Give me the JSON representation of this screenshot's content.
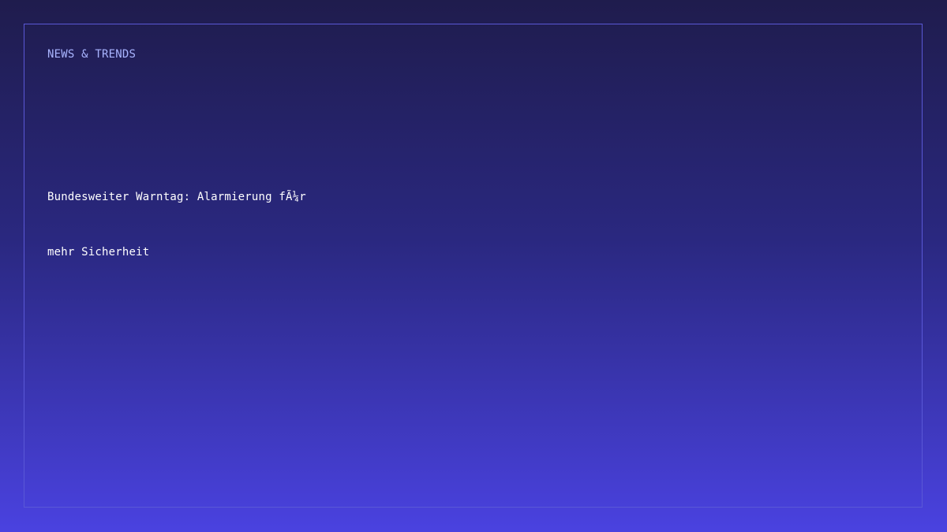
{
  "section_label": "NEWS & TRENDS",
  "headline": {
    "line1": "Bundesweiter Warntag: Alarmierung fÃ¼r",
    "line2": "mehr Sicherheit"
  },
  "colors": {
    "background_top": "#1f1c4d",
    "background_bottom": "#4a42e0",
    "frame_border": "#5a58d6",
    "kicker_text": "#a9b4ff",
    "headline_text": "#ffffff"
  }
}
